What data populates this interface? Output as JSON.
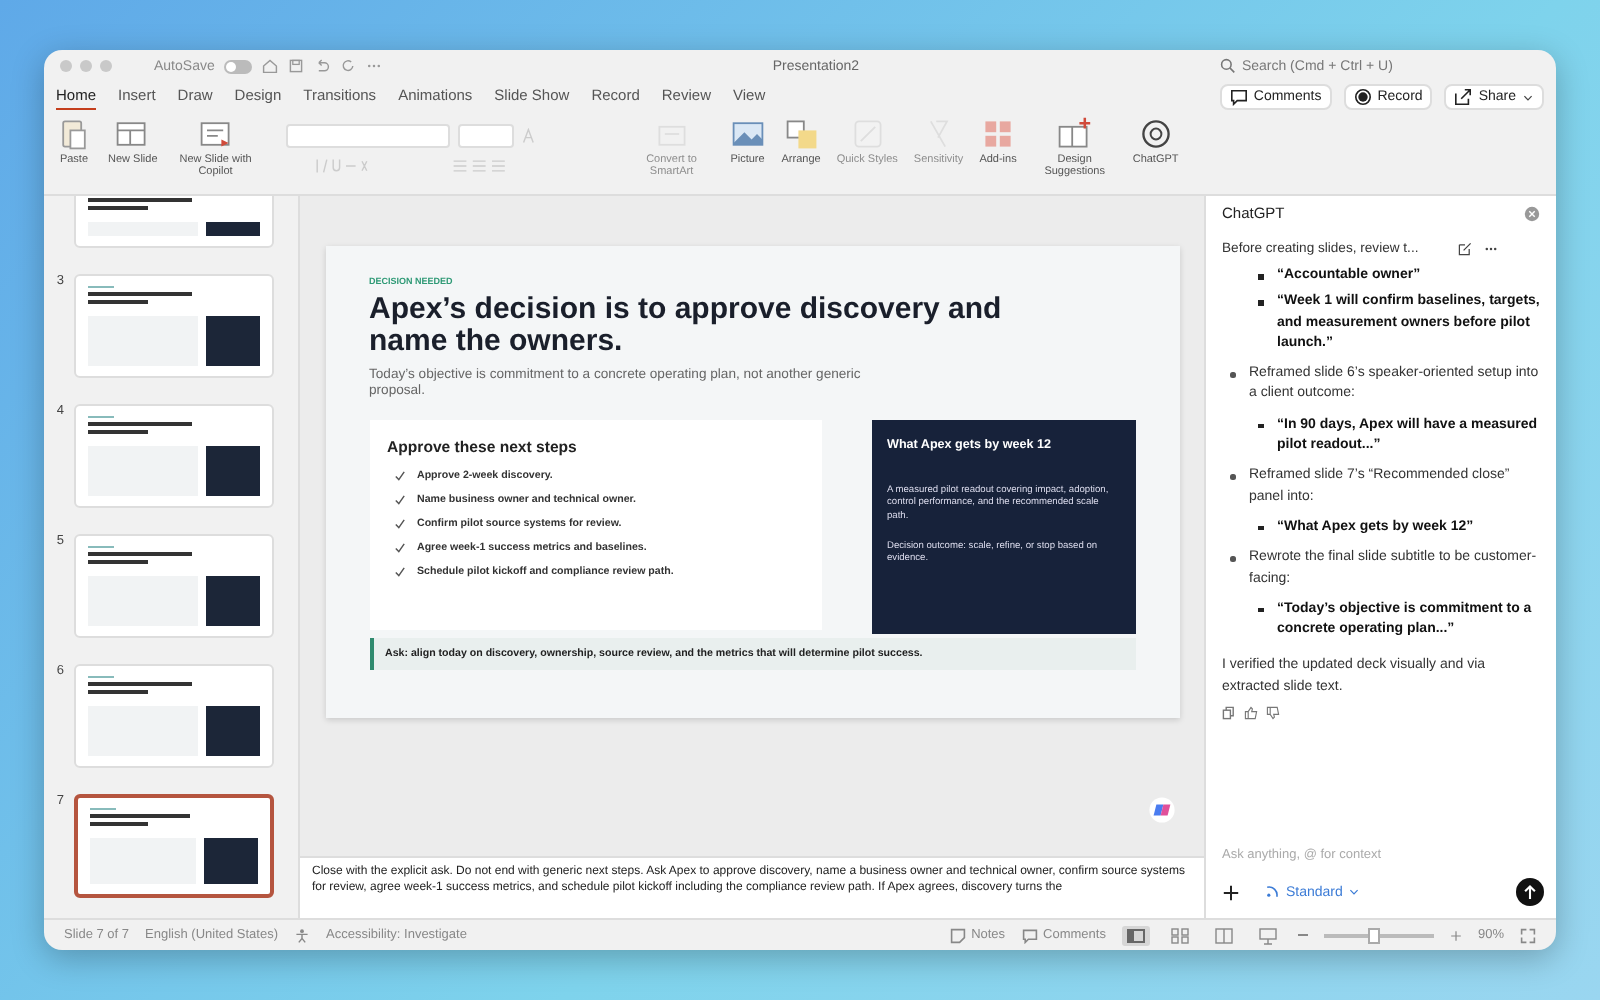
{
  "window": {
    "title": "Presentation2",
    "autosave_label": "AutoSave",
    "autosave_on": false
  },
  "search": {
    "placeholder": "Search (Cmd + Ctrl + U)"
  },
  "header_buttons": [
    {
      "kind": "comments",
      "label": "Comments"
    },
    {
      "kind": "record",
      "label": "Record"
    },
    {
      "kind": "share",
      "label": "Share"
    }
  ],
  "tabs": [
    {
      "label": "Home",
      "selected": true
    },
    {
      "label": "Insert",
      "selected": false
    },
    {
      "label": "Draw",
      "selected": false
    },
    {
      "label": "Design",
      "selected": false
    },
    {
      "label": "Transitions",
      "selected": false
    },
    {
      "label": "Animations",
      "selected": false
    },
    {
      "label": "Slide Show",
      "selected": false
    },
    {
      "label": "Record",
      "selected": false
    },
    {
      "label": "Review",
      "selected": false
    },
    {
      "label": "View",
      "selected": false
    }
  ],
  "ribbon": [
    {
      "kind": "paste",
      "label": "Paste",
      "disabled": false
    },
    {
      "kind": "new-slide",
      "label": "New Slide",
      "disabled": false
    },
    {
      "kind": "copilot-slide",
      "label": "New Slide with Copilot",
      "disabled": false
    },
    {
      "kind": "font"
    },
    {
      "kind": "smartart",
      "label": "Convert to SmartArt",
      "disabled": true
    },
    {
      "kind": "picture",
      "label": "Picture",
      "disabled": false
    },
    {
      "kind": "arrange",
      "label": "Arrange",
      "disabled": false
    },
    {
      "kind": "styles",
      "label": "Quick Styles",
      "disabled": true
    },
    {
      "kind": "sensitivity",
      "label": "Sensitivity",
      "disabled": true
    },
    {
      "kind": "addins",
      "label": "Add-ins",
      "disabled": false
    },
    {
      "kind": "design",
      "label": "Design Suggestions",
      "disabled": false
    },
    {
      "kind": "chatgpt",
      "label": "ChatGPT",
      "disabled": false
    }
  ],
  "thumbnails": [
    {
      "selected": false
    },
    {
      "number": "3",
      "selected": false
    },
    {
      "number": "4",
      "selected": false
    },
    {
      "number": "5",
      "selected": false
    },
    {
      "number": "6",
      "selected": false
    },
    {
      "number": "7",
      "selected": true
    }
  ],
  "slide": {
    "eyebrow": "DECISION NEEDED",
    "title": "Apex’s decision is to approve discovery and name the owners.",
    "subtitle": "Today’s objective is commitment to a concrete operating plan, not another generic proposal.",
    "steps_title": "Approve these next steps",
    "steps": [
      "Approve 2-week discovery.",
      "Name business owner and technical owner.",
      "Confirm pilot source systems for review.",
      "Agree week-1 success metrics and baselines.",
      "Schedule pilot kickoff and compliance review path."
    ],
    "outcome_title": "What Apex gets by week 12",
    "outcome_text": "A measured pilot readout covering impact, adoption, control performance, and the recommended scale path.",
    "outcome_decision": "Decision outcome: scale, refine, or stop based on evidence.",
    "ask": "Ask: align today on discovery, ownership, source review, and the metrics that will determine pilot success."
  },
  "notes": "Close with the explicit ask. Do not end with generic next steps. Ask Apex to approve discovery, name a business owner and technical owner, confirm source systems for review, agree week-1 success metrics, and schedule pilot kickoff including the compliance review path. If Apex agrees, discovery turns the",
  "chat": {
    "title": "ChatGPT",
    "thread_title": "Before creating slides, review t...",
    "bullets": [
      {
        "children": [
          "“Accountable owner”",
          "“Week 1 will confirm baselines, targets, and measurement owners before pilot launch.”"
        ]
      },
      {
        "text": "Reframed slide 6’s speaker-oriented setup into a client outcome:",
        "children": [
          "“In 90 days, Apex will have a measured pilot readout...”"
        ]
      },
      {
        "text": "Reframed slide 7’s “Recommended close” panel into:",
        "children": [
          "“What Apex gets by week 12”"
        ]
      },
      {
        "text": "Rewrote the final slide subtitle to be customer-facing:",
        "children": [
          "“Today’s objective is commitment to a concrete operating plan...”"
        ]
      }
    ],
    "closing": "I verified the updated deck visually and via extracted slide text.",
    "input_placeholder": "Ask anything, @ for context",
    "mode": "Standard"
  },
  "status_bar": {
    "slide": "Slide 7 of 7",
    "language": "English (United States)",
    "accessibility": "Accessibility: Investigate",
    "notes": "Notes",
    "comments": "Comments",
    "views": [
      {
        "kind": "normal",
        "selected": true
      },
      {
        "kind": "sorter",
        "selected": false
      },
      {
        "kind": "reading",
        "selected": false
      },
      {
        "kind": "presenter",
        "selected": false
      }
    ],
    "zoom": {
      "reading": "90%",
      "level": 0.45
    }
  }
}
